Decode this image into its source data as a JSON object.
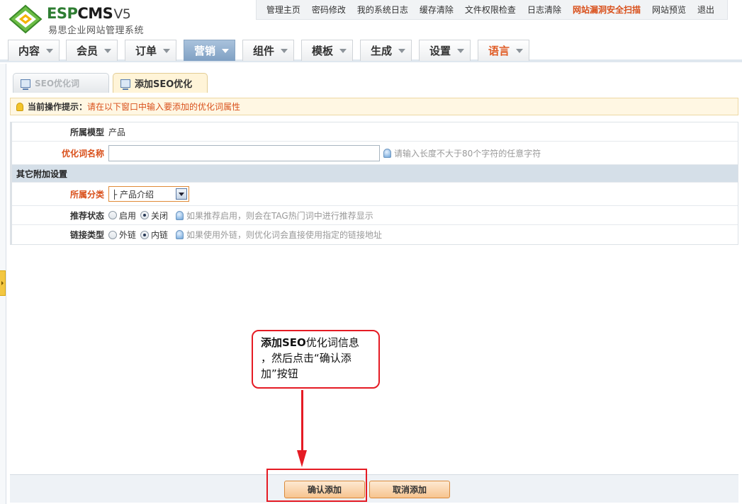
{
  "logo": {
    "esp": "ESP",
    "cms": "CMS",
    "version": "V5",
    "subtitle": "易思企业网站管理系统"
  },
  "topnav": [
    {
      "label": "管理主页"
    },
    {
      "label": "密码修改"
    },
    {
      "label": "我的系统日志"
    },
    {
      "label": "缓存清除"
    },
    {
      "label": "文件权限检查"
    },
    {
      "label": "日志清除"
    },
    {
      "label": "网站漏洞安全扫描"
    },
    {
      "label": "网站预览"
    },
    {
      "label": "退出"
    }
  ],
  "menu": [
    {
      "label": "内容"
    },
    {
      "label": "会员"
    },
    {
      "label": "订单"
    },
    {
      "label": "营销",
      "active": true
    },
    {
      "label": "组件"
    },
    {
      "label": "模板"
    },
    {
      "label": "生成"
    },
    {
      "label": "设置"
    },
    {
      "label": "语言"
    }
  ],
  "tabs": [
    {
      "label": "SEO优化词"
    },
    {
      "label": "添加SEO优化"
    }
  ],
  "tip": {
    "label": "当前操作提示：",
    "text": "请在以下窗口中输入要添加的优化词属性"
  },
  "form": {
    "model": {
      "label": "所属模型",
      "value": "产品"
    },
    "keyword": {
      "label": "优化词名称",
      "value": "",
      "hint": "请输入长度不大于80个字符的任意字符"
    },
    "section_title": "其它附加设置",
    "category": {
      "label": "所属分类",
      "selected": "├ 产品介绍"
    },
    "recommend": {
      "label": "推荐状态",
      "options": [
        "启用",
        "关闭"
      ],
      "selected": "关闭",
      "hint": "如果推荐启用，则会在TAG热门词中进行推荐显示"
    },
    "link_type": {
      "label": "链接类型",
      "options": [
        "外链",
        "内链"
      ],
      "selected": "内链",
      "hint": "如果使用外链，则优化词会直接使用指定的链接地址"
    }
  },
  "buttons": {
    "confirm": "确认添加",
    "cancel": "取消添加"
  },
  "annotation": {
    "line1_bold": "添加SEO",
    "line1_rest": "优化词信息",
    "line2": "，然后点击“确认添",
    "line3": "加”按钮"
  },
  "colors": {
    "accent_orange": "#d9501b",
    "menu_active": "#7fa0c3",
    "annotation_red": "#e51b24",
    "button_bg": "#f7c48f"
  }
}
